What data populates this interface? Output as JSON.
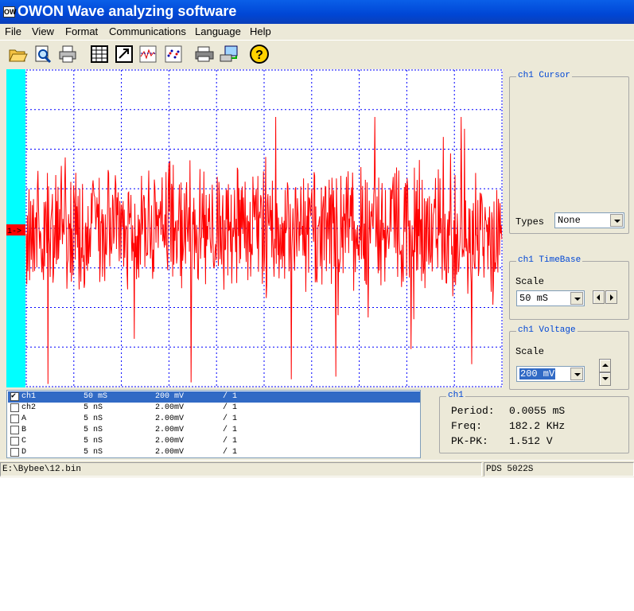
{
  "window": {
    "title": "OWON Wave analyzing software",
    "icon": "app-logo-icon",
    "icon_glyph": "OW"
  },
  "menu": [
    "File",
    "View",
    "Format",
    "Communications",
    "Language",
    "Help"
  ],
  "toolbar": [
    {
      "name": "open-folder-icon"
    },
    {
      "name": "zoom-preview-icon"
    },
    {
      "name": "print-icon"
    },
    {
      "name": "table-view-icon"
    },
    {
      "name": "export-icon"
    },
    {
      "name": "waveform-view-icon"
    },
    {
      "name": "point-view-icon"
    },
    {
      "name": "printer-setup-icon"
    },
    {
      "name": "connect-device-icon"
    },
    {
      "name": "help-icon"
    }
  ],
  "scope": {
    "marker": "1->",
    "colors": {
      "trace": "#ff0000",
      "grid": "#0000ff",
      "left_bar": "#00ffff",
      "marker_bg": "#ff0000"
    },
    "grid": {
      "h_divisions": 10,
      "v_divisions": 8
    }
  },
  "cursor_panel": {
    "title": "ch1 Cursor",
    "types_label": "Types",
    "types_value": "None"
  },
  "timebase_panel": {
    "title": "ch1 TimeBase",
    "scale_label": "Scale",
    "scale_value": "50 mS"
  },
  "voltage_panel": {
    "title": "ch1 Voltage",
    "scale_label": "Scale",
    "scale_value": "200 mV"
  },
  "channels": [
    {
      "name": "ch1",
      "timebase": "50 mS",
      "voltage": "200 mV",
      "probe": "/ 1",
      "checked": true,
      "selected": true
    },
    {
      "name": "ch2",
      "timebase": "5 nS",
      "voltage": "2.00mV",
      "probe": "/ 1",
      "checked": false,
      "selected": false
    },
    {
      "name": "A",
      "timebase": "5 nS",
      "voltage": "2.00mV",
      "probe": "/ 1",
      "checked": false,
      "selected": false
    },
    {
      "name": "B",
      "timebase": "5 nS",
      "voltage": "2.00mV",
      "probe": "/ 1",
      "checked": false,
      "selected": false
    },
    {
      "name": "C",
      "timebase": "5 nS",
      "voltage": "2.00mV",
      "probe": "/ 1",
      "checked": false,
      "selected": false
    },
    {
      "name": "D",
      "timebase": "5 nS",
      "voltage": "2.00mV",
      "probe": "/ 1",
      "checked": false,
      "selected": false
    }
  ],
  "measure": {
    "title": "ch1",
    "period_label": "Period:",
    "period_value": "0.0055 mS",
    "freq_label": "Freq:",
    "freq_value": "182.2 KHz",
    "pkpk_label": "PK-PK:",
    "pkpk_value": "1.512 V"
  },
  "status": {
    "path": "E:\\Bybee\\12.bin",
    "device": "PDS 5022S"
  }
}
